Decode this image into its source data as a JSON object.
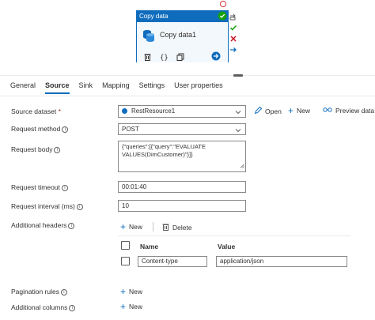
{
  "activity": {
    "header": "Copy data",
    "name": "Copy data1",
    "status_color": "#13a10e",
    "accent_color": "#0f6cbd"
  },
  "tabs": [
    {
      "label": "General",
      "active": false
    },
    {
      "label": "Source",
      "active": true
    },
    {
      "label": "Sink",
      "active": false
    },
    {
      "label": "Mapping",
      "active": false
    },
    {
      "label": "Settings",
      "active": false
    },
    {
      "label": "User properties",
      "active": false
    }
  ],
  "source_dataset": {
    "label": "Source dataset",
    "required_mark": "*",
    "value": "RestResource1",
    "open_label": "Open",
    "new_label": "New",
    "preview_label": "Preview data"
  },
  "request_method": {
    "label": "Request method",
    "value": "POST"
  },
  "request_body": {
    "label": "Request body",
    "value": "{\"queries\":[{\"query\":\"EVALUATE\nVALUES(DimCustomer)\"}]}"
  },
  "request_timeout": {
    "label": "Request timeout",
    "value": "00:01:40"
  },
  "request_interval": {
    "label": "Request interval (ms)",
    "value": "10"
  },
  "additional_headers": {
    "label": "Additional headers",
    "new_label": "New",
    "delete_label": "Delete",
    "columns": [
      "Name",
      "Value"
    ],
    "rows": [
      {
        "name": "Content-type",
        "value": "application/json"
      }
    ]
  },
  "pagination_rules": {
    "label": "Pagination rules",
    "new_label": "New"
  },
  "additional_columns": {
    "label": "Additional columns",
    "new_label": "New"
  }
}
